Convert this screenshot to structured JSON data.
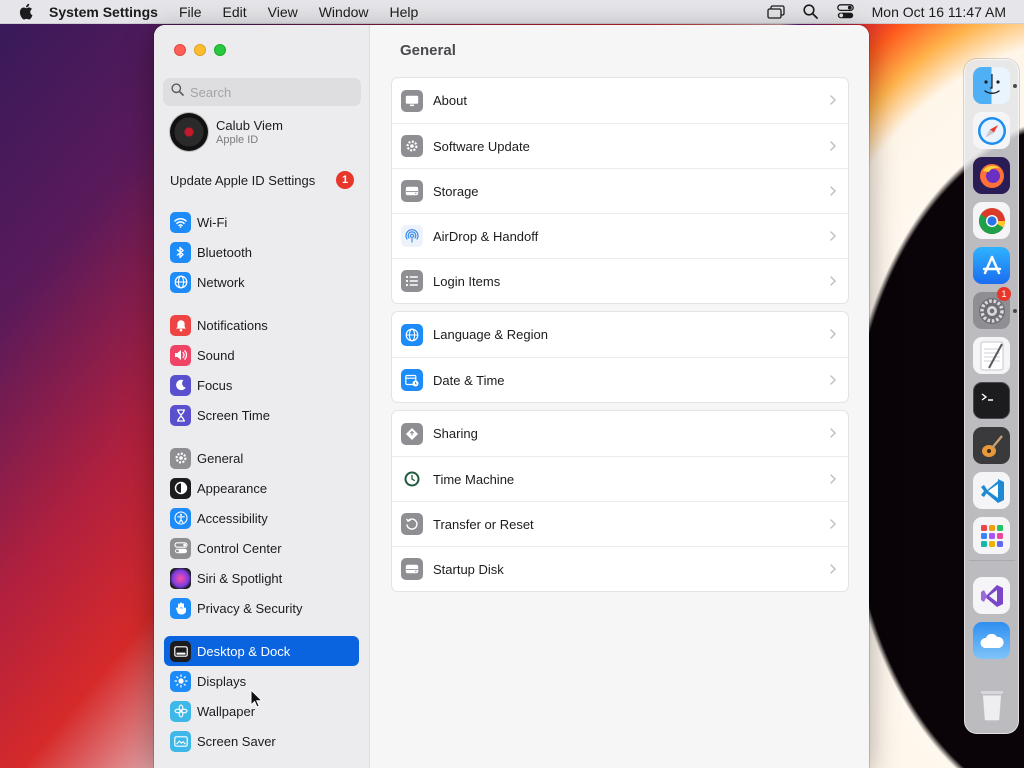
{
  "menubar": {
    "app_name": "System Settings",
    "menus": [
      "File",
      "Edit",
      "View",
      "Window",
      "Help"
    ],
    "clock": "Mon Oct 16  11:47 AM"
  },
  "window": {
    "search": {
      "placeholder": "Search"
    },
    "profile": {
      "name": "Calub Viem",
      "subtitle": "Apple ID"
    },
    "update": {
      "label": "Update Apple ID Settings",
      "badge": "1"
    },
    "sidebar_groups": [
      [
        {
          "label": "Wi-Fi",
          "icon": "wifi-icon",
          "color": "#1d8cf8"
        },
        {
          "label": "Bluetooth",
          "icon": "bluetooth-icon",
          "color": "#1d8cf8"
        },
        {
          "label": "Network",
          "icon": "globe-icon",
          "color": "#1d8cf8"
        }
      ],
      [
        {
          "label": "Notifications",
          "icon": "bell-icon",
          "color": "#ef4444"
        },
        {
          "label": "Sound",
          "icon": "speaker-icon",
          "color": "#ef4466"
        },
        {
          "label": "Focus",
          "icon": "moon-icon",
          "color": "#5a4fcf"
        },
        {
          "label": "Screen Time",
          "icon": "hourglass-icon",
          "color": "#5a4fcf"
        }
      ],
      [
        {
          "label": "General",
          "icon": "gear-icon",
          "color": "#8e8e93"
        },
        {
          "label": "Appearance",
          "icon": "appearance-icon",
          "color": "#1c1c1e"
        },
        {
          "label": "Accessibility",
          "icon": "accessibility-icon",
          "color": "#1d8cf8"
        },
        {
          "label": "Control Center",
          "icon": "switches-icon",
          "color": "#8e8e93"
        },
        {
          "label": "Siri & Spotlight",
          "icon": "siri-icon",
          "color": "#9b3fbf"
        },
        {
          "label": "Privacy & Security",
          "icon": "hand-icon",
          "color": "#1d8cf8"
        }
      ],
      [
        {
          "label": "Desktop & Dock",
          "icon": "dock-icon",
          "color": "#1c1c1e",
          "selected": true
        },
        {
          "label": "Displays",
          "icon": "sun-icon",
          "color": "#1d8cf8"
        },
        {
          "label": "Wallpaper",
          "icon": "flower-icon",
          "color": "#3db8e8"
        },
        {
          "label": "Screen Saver",
          "icon": "screen-saver-icon",
          "color": "#3db8e8"
        }
      ]
    ],
    "content_title": "General",
    "content_groups": [
      [
        {
          "label": "About",
          "icon": "display-icon",
          "color": "#8e8e93"
        },
        {
          "label": "Software Update",
          "icon": "gear-badge-icon",
          "color": "#8e8e93"
        },
        {
          "label": "Storage",
          "icon": "drive-icon",
          "color": "#8e8e93"
        },
        {
          "label": "AirDrop & Handoff",
          "icon": "airdrop-icon",
          "color": "#eef3fb"
        },
        {
          "label": "Login Items",
          "icon": "list-icon",
          "color": "#8e8e93"
        }
      ],
      [
        {
          "label": "Language & Region",
          "icon": "globe-icon",
          "color": "#1d8cf8"
        },
        {
          "label": "Date & Time",
          "icon": "calendar-clock-icon",
          "color": "#1d8cf8"
        }
      ],
      [
        {
          "label": "Sharing",
          "icon": "sharing-icon",
          "color": "#8e8e93"
        },
        {
          "label": "Time Machine",
          "icon": "time-machine-icon",
          "color": "#2e8b57"
        },
        {
          "label": "Transfer or Reset",
          "icon": "reset-icon",
          "color": "#8e8e93"
        },
        {
          "label": "Startup Disk",
          "icon": "drive-icon",
          "color": "#8e8e93"
        }
      ]
    ]
  },
  "dock": {
    "apps": [
      {
        "name": "finder-icon",
        "running": true
      },
      {
        "name": "safari-icon",
        "running": false
      },
      {
        "name": "firefox-icon",
        "running": false
      },
      {
        "name": "chrome-icon",
        "running": false
      },
      {
        "name": "app-store-icon",
        "running": false
      },
      {
        "name": "system-settings-icon",
        "running": true,
        "badge": "1"
      },
      {
        "name": "textedit-icon",
        "running": false
      },
      {
        "name": "terminal-icon",
        "running": false
      },
      {
        "name": "garageband-icon",
        "running": false
      },
      {
        "name": "vscode-icon",
        "running": false
      },
      {
        "name": "launchpad-icon",
        "running": false
      },
      {
        "name": "visual-studio-icon",
        "running": false
      },
      {
        "name": "weather-icon",
        "running": false
      },
      {
        "name": "trash-icon",
        "running": false
      }
    ]
  }
}
